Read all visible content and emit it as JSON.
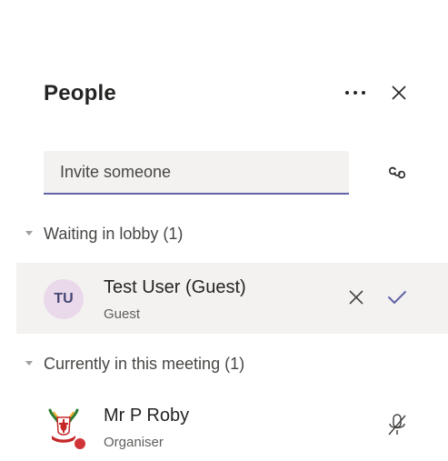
{
  "panel": {
    "title": "People"
  },
  "invite": {
    "placeholder": "Invite someone",
    "value": ""
  },
  "lobby": {
    "heading": "Waiting in lobby (1)",
    "participants": [
      {
        "initials": "TU",
        "name": "Test User (Guest)",
        "role": "Guest"
      }
    ]
  },
  "meeting": {
    "heading": "Currently in this meeting (1)",
    "participants": [
      {
        "name": "Mr P Roby",
        "role": "Organiser"
      }
    ]
  },
  "icons": {
    "more": "more-options-icon",
    "close": "close-icon",
    "link": "copy-link-icon",
    "caret": "caret-down-icon",
    "deny": "deny-x-icon",
    "admit": "admit-check-icon",
    "mic": "mic-off-icon"
  },
  "colors": {
    "accent": "#6264a7",
    "avatar_bg": "#e9d9ea",
    "lobby_row_bg": "#f3f2f1",
    "status_busy": "#d13438"
  }
}
